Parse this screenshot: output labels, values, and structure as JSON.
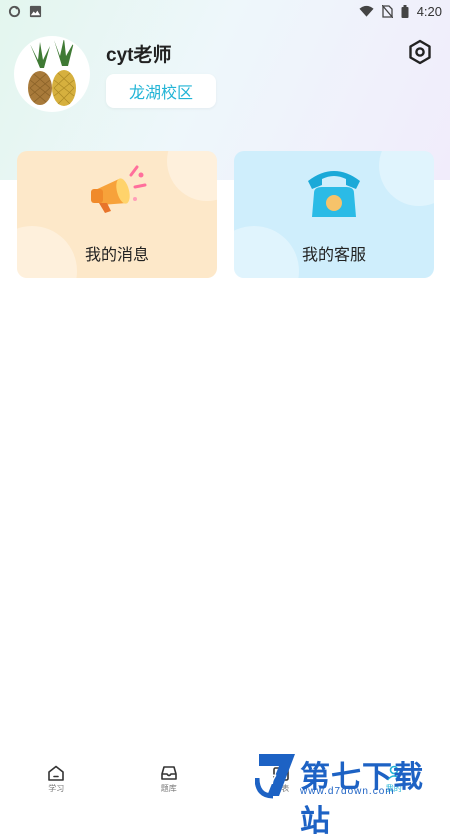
{
  "status_bar": {
    "time": "4:20",
    "left_icons": [
      "sync-icon",
      "gallery-icon"
    ],
    "right_icons": [
      "wifi-icon",
      "no-sim-icon",
      "battery-icon"
    ]
  },
  "profile": {
    "name": "cyt老师",
    "campus": "龙湖校区",
    "avatar_icon": "pineapple-avatar",
    "settings_icon": "settings-hex-icon"
  },
  "cards": {
    "messages": {
      "label": "我的消息",
      "icon": "megaphone-icon",
      "color": "#fde8c9"
    },
    "service": {
      "label": "我的客服",
      "icon": "telephone-icon",
      "color": "#cfeefc"
    }
  },
  "tabs": [
    {
      "label": "学习",
      "icon": "home-icon",
      "active": false
    },
    {
      "label": "题库",
      "icon": "tray-icon",
      "active": false
    },
    {
      "label": "课表",
      "icon": "schedule-icon",
      "active": false
    },
    {
      "label": "我的",
      "icon": "profile-icon",
      "active": true
    }
  ],
  "watermark": {
    "title": "第七下载站",
    "url": "www.d7down.com",
    "logo_letter": "7"
  },
  "colors": {
    "accent": "#22b4d6",
    "watermark": "#1d62c4"
  }
}
